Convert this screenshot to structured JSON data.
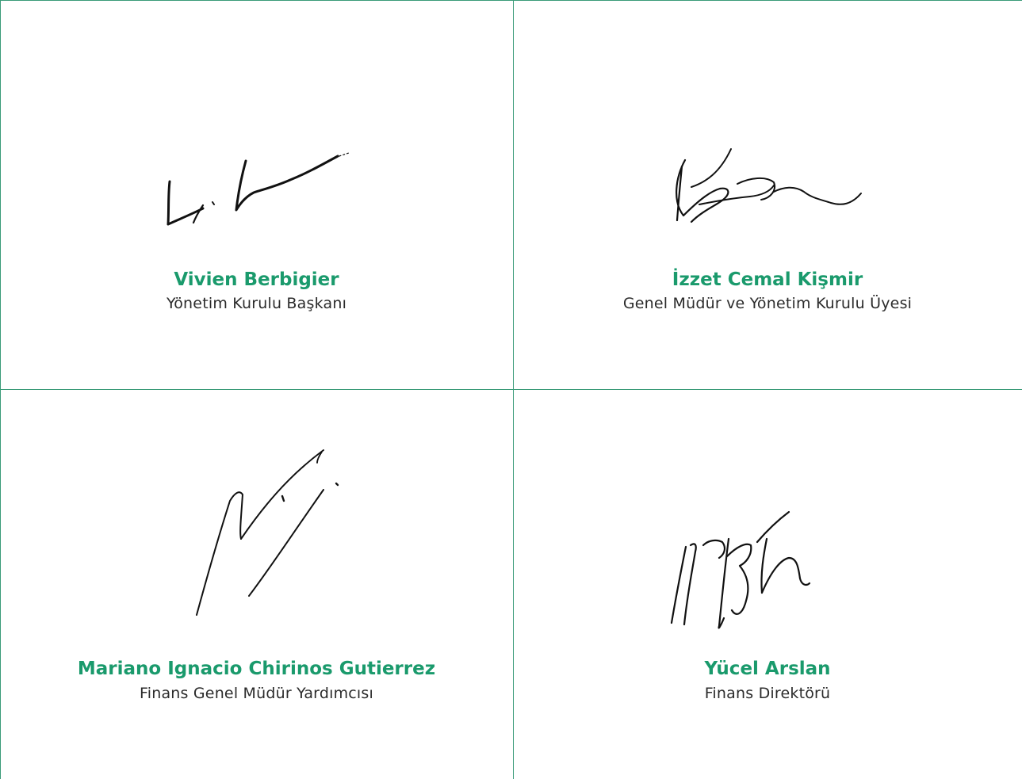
{
  "colors": {
    "accent": "#1a9a6c",
    "grid_line": "#3a9b78",
    "text": "#2b2b2b"
  },
  "signatories": [
    {
      "name": "Vivien Berbigier",
      "title": "Yönetim Kurulu Başkanı"
    },
    {
      "name": "İzzet Cemal Kişmir",
      "title": "Genel Müdür ve Yönetim Kurulu Üyesi"
    },
    {
      "name": "Mariano Ignacio Chirinos Gutierrez",
      "title": "Finans Genel Müdür Yardımcısı"
    },
    {
      "name": "Yücel Arslan",
      "title": "Finans Direktörü"
    }
  ]
}
